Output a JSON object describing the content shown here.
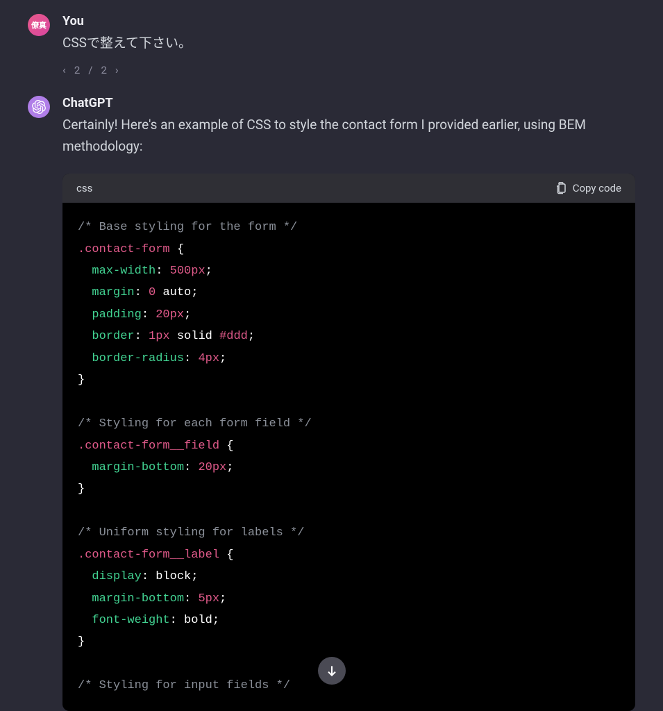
{
  "user": {
    "author": "You",
    "avatar_text": "僚真",
    "message": "CSSで整えて下さい。",
    "pagination": {
      "current": "2",
      "total": "2",
      "sep": "/"
    }
  },
  "assistant": {
    "author": "ChatGPT",
    "message": "Certainly! Here's an example of CSS to style the contact form I provided earlier, using BEM methodology:",
    "code": {
      "language": "css",
      "copy_label": "Copy code",
      "lines": [
        {
          "type": "comment",
          "text": "/* Base styling for the form */"
        },
        {
          "type": "selector-open",
          "selector": ".contact-form"
        },
        {
          "type": "prop",
          "prop": "max-width",
          "num": "500",
          "unit": "px"
        },
        {
          "type": "prop2",
          "prop": "margin",
          "num": "0",
          "val": "auto"
        },
        {
          "type": "prop",
          "prop": "padding",
          "num": "20",
          "unit": "px"
        },
        {
          "type": "prop-border",
          "prop": "border",
          "num": "1",
          "unit": "px",
          "val": "solid",
          "hex": "#ddd"
        },
        {
          "type": "prop",
          "prop": "border-radius",
          "num": "4",
          "unit": "px"
        },
        {
          "type": "close"
        },
        {
          "type": "blank"
        },
        {
          "type": "comment",
          "text": "/* Styling for each form field */"
        },
        {
          "type": "selector-open",
          "selector": ".contact-form__field"
        },
        {
          "type": "prop",
          "prop": "margin-bottom",
          "num": "20",
          "unit": "px"
        },
        {
          "type": "close"
        },
        {
          "type": "blank"
        },
        {
          "type": "comment",
          "text": "/* Uniform styling for labels */"
        },
        {
          "type": "selector-open",
          "selector": ".contact-form__label"
        },
        {
          "type": "prop-val",
          "prop": "display",
          "val": "block"
        },
        {
          "type": "prop",
          "prop": "margin-bottom",
          "num": "5",
          "unit": "px"
        },
        {
          "type": "prop-val",
          "prop": "font-weight",
          "val": "bold"
        },
        {
          "type": "close"
        },
        {
          "type": "blank"
        },
        {
          "type": "comment",
          "text": "/* Styling for input fields */"
        }
      ]
    }
  }
}
